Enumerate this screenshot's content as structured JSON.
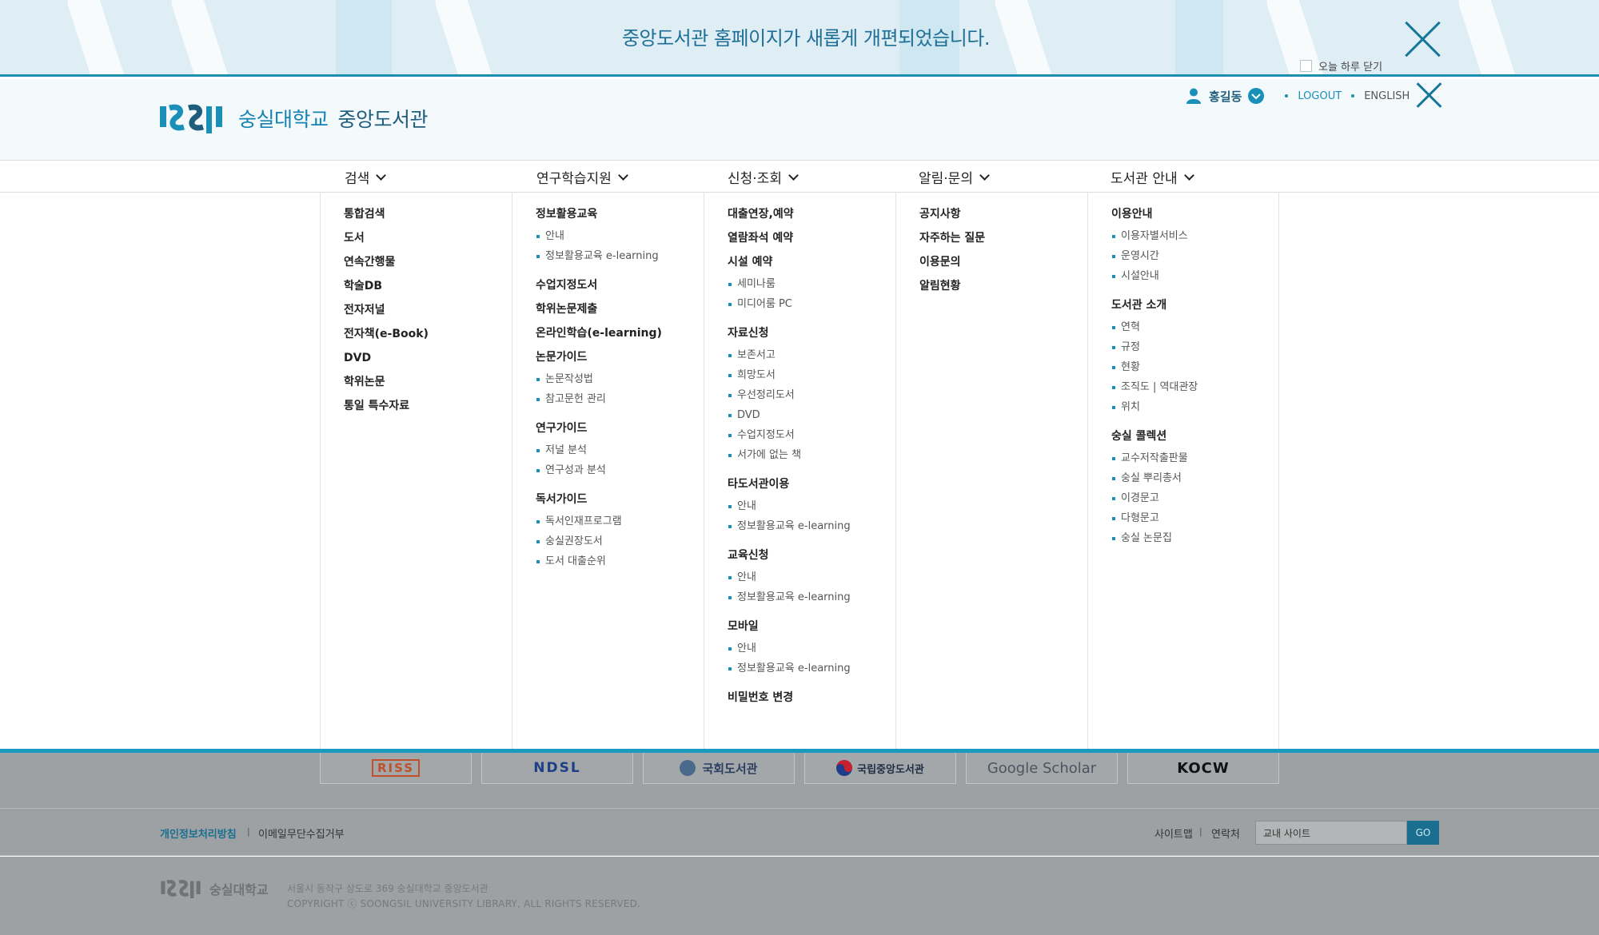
{
  "notice": {
    "message": "중앙도서관 홈페이지가 새롭게 개편되었습니다.",
    "today_close_label": "오늘 하루 닫기"
  },
  "header": {
    "logo_text_1": "숭실대학교",
    "logo_text_2": "중앙도서관",
    "user_name": "홍길동",
    "logout_label": "LOGOUT",
    "english_label": "ENGLISH"
  },
  "gnb": [
    {
      "label": "검색"
    },
    {
      "label": "연구학습지원"
    },
    {
      "label": "신청·조회"
    },
    {
      "label": "알림·문의"
    },
    {
      "label": "도서관 안내"
    }
  ],
  "menu": {
    "search": [
      "통합검색",
      "도서",
      "연속간행물",
      "학술DB",
      "전자저널",
      "전자책(e-Book)",
      "DVD",
      "학위논문",
      "통일 특수자료"
    ],
    "research": {
      "info_edu": "정보활용교육",
      "info_edu_sub": [
        "안내",
        "정보활용교육 e-learning"
      ],
      "class_books": "수업지정도서",
      "thesis_submit": "학위논문제출",
      "online_learning": "온라인학습(e-learning)",
      "paper_guide": "논문가이드",
      "paper_guide_sub": [
        "논문작성법",
        "참고문헌 관리"
      ],
      "research_guide": "연구가이드",
      "research_guide_sub": [
        "저널 분석",
        "연구성과 분석"
      ],
      "reading_guide": "독서가이드",
      "reading_guide_sub": [
        "독서인재프로그램",
        "숭실권장도서",
        "도서 대출순위"
      ]
    },
    "apply": {
      "loan_ext": "대출연장,예약",
      "reading_seat": "열람좌석 예약",
      "facility": "시설 예약",
      "facility_sub": [
        "세미나룸",
        "미디어룸 PC"
      ],
      "material": "자료신청",
      "material_sub": [
        "보존서고",
        "희망도서",
        "우선정리도서",
        "DVD",
        "수업지정도서",
        "서가에 없는 책"
      ],
      "other_lib": "타도서관이용",
      "other_lib_sub": [
        "안내",
        "정보활용교육 e-learning"
      ],
      "edu_apply": "교육신청",
      "edu_apply_sub": [
        "안내",
        "정보활용교육 e-learning"
      ],
      "mobile": "모바일",
      "mobile_sub": [
        "안내",
        "정보활용교육 e-learning"
      ],
      "password": "비밀번호 변경"
    },
    "notice": [
      "공지사항",
      "자주하는 질문",
      "이용문의",
      "알림현황"
    ],
    "about": {
      "usage": "이용안내",
      "usage_sub": [
        "이용자별서비스",
        "운영시간",
        "시설안내"
      ],
      "intro": "도서관 소개",
      "intro_sub": [
        "연혁",
        "규정",
        "현황",
        "조직도 | 역대관장",
        "위치"
      ],
      "collection": "숭실 콜렉션",
      "collection_sub": [
        "교수저작출판물",
        "숭실 뿌리총서",
        "이경문고",
        "다형문고",
        "숭실 논문집"
      ]
    }
  },
  "sites": [
    {
      "label": "RISS",
      "color": "#c0502a"
    },
    {
      "label": "NDSL",
      "color": "#1c3f86"
    },
    {
      "label": "국회도서관",
      "color": "#2a3f5f"
    },
    {
      "label": "국립중앙도서관",
      "color": "#1f2d44"
    },
    {
      "label": "Google Scholar",
      "color": "#4285f4"
    },
    {
      "label": "KOCW",
      "color": "#111111"
    }
  ],
  "footer": {
    "privacy": "개인정보처리방침",
    "email_refuse": "이메일무단수집거부",
    "sitemap": "사이트맵",
    "contact": "연락처",
    "site_select": "교내 사이트",
    "go": "GO",
    "logo_text": "숭실대학교",
    "address": "서울시 동작구 상도로 369 숭실대학교 중앙도서관",
    "copyright": "COPYRIGHT ⓒ SOONGSIL UNIVERSITY LIBRARY, ALL RIGHTS RESERVED."
  },
  "colors": {
    "accent": "#1a8fb8",
    "dark_accent": "#1a6f90",
    "footer_bg": "#9ea1a3"
  }
}
